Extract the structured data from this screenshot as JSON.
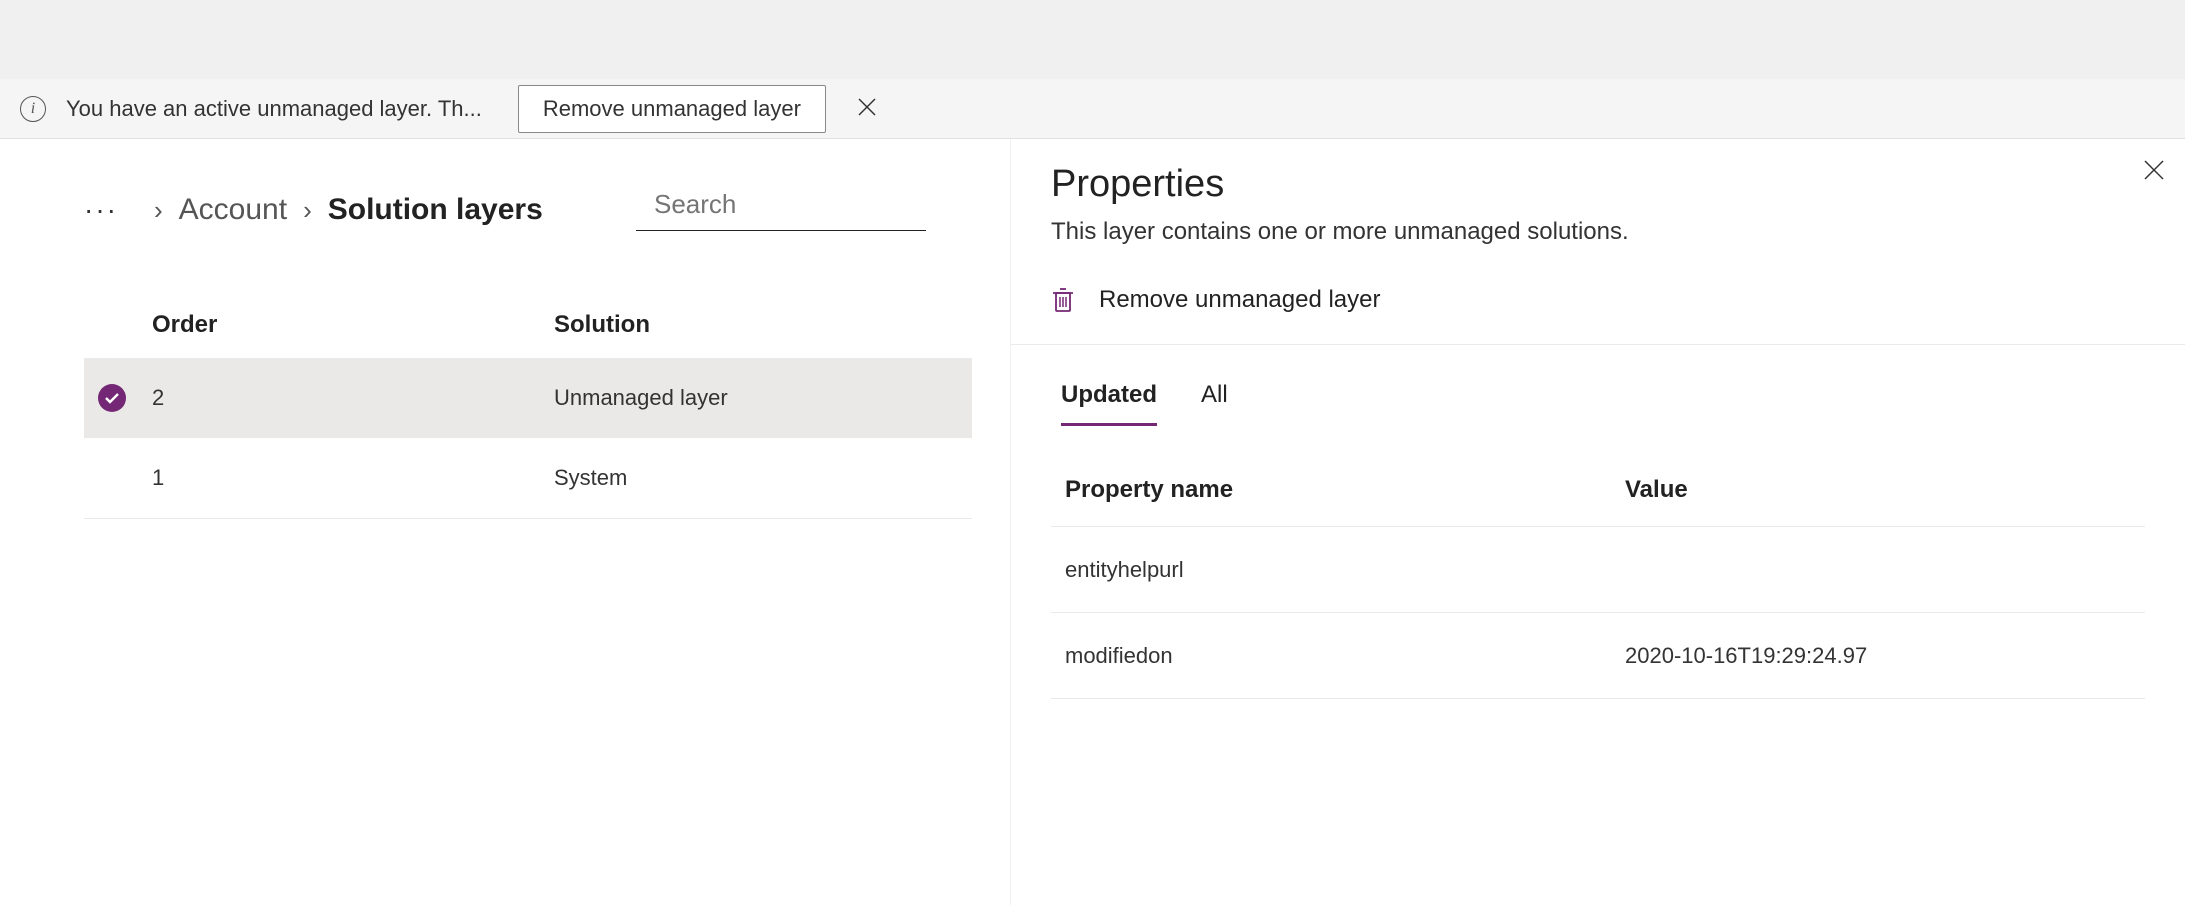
{
  "notification": {
    "text": "You have an active unmanaged layer. Th...",
    "button_label": "Remove unmanaged layer"
  },
  "breadcrumb": {
    "items": [
      "Account",
      "Solution layers"
    ]
  },
  "search": {
    "placeholder": "Search"
  },
  "layers_table": {
    "columns": {
      "order": "Order",
      "solution": "Solution"
    },
    "rows": [
      {
        "order": "2",
        "solution": "Unmanaged layer",
        "selected": true
      },
      {
        "order": "1",
        "solution": "System",
        "selected": false
      }
    ]
  },
  "properties_panel": {
    "title": "Properties",
    "subtitle": "This layer contains one or more unmanaged solutions.",
    "remove_action_label": "Remove unmanaged layer",
    "tabs": [
      {
        "label": "Updated",
        "active": true
      },
      {
        "label": "All",
        "active": false
      }
    ],
    "columns": {
      "name": "Property name",
      "value": "Value"
    },
    "rows": [
      {
        "name": "entityhelpurl",
        "value": ""
      },
      {
        "name": "modifiedon",
        "value": "2020-10-16T19:29:24.97"
      }
    ]
  }
}
